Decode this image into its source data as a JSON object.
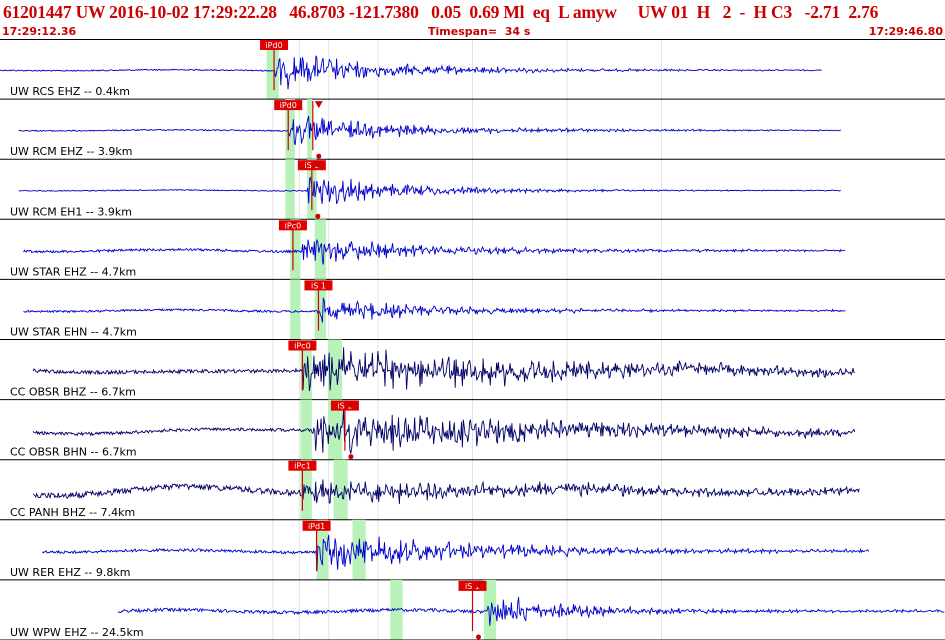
{
  "header": {
    "event_line": "61201447 UW 2016-10-02 17:29:22.28   46.8703 -121.7380   0.05  0.69 Ml  eq  L amyw     UW 01  H   2  -  H C3   -2.71  2.76",
    "start_time": "17:29:12.36",
    "timespan": "Timespan=  34 s",
    "end_time": "17:29:46.80"
  },
  "colors": {
    "header_text": "#cc0000",
    "trace": "#0000cc",
    "trace_cc": "#000066",
    "window": "#b8f2b8",
    "pick": "#cc0000",
    "pick_label_bg": "#e00000",
    "grid": "#000000"
  },
  "traces": [
    {
      "label": "UW RCS EHZ -- 0.4km",
      "color": "trace",
      "start": 0.0,
      "end": 0.87,
      "onset": 0.29,
      "amp": 22,
      "noise": 0.6,
      "decay": 0.12,
      "windows": [
        [
          0.282,
          0.295
        ]
      ],
      "picks": [
        {
          "label": "iPd0",
          "x": 0.29,
          "type": "P",
          "triangle": false
        }
      ]
    },
    {
      "label": "UW RCM EHZ -- 3.9km",
      "color": "trace",
      "start": 0.02,
      "end": 0.89,
      "onset": 0.305,
      "amp": 18,
      "noise": 0.6,
      "decay": 0.12,
      "windows": [
        [
          0.302,
          0.312
        ],
        [
          0.325,
          0.33
        ]
      ],
      "picks": [
        {
          "label": "iPd0",
          "x": 0.305,
          "type": "P",
          "triangle": false
        },
        {
          "label": "",
          "x": 0.331,
          "type": "S",
          "triangle": true
        }
      ]
    },
    {
      "label": "UW RCM EH1 -- 3.9km",
      "color": "trace",
      "start": 0.02,
      "end": 0.89,
      "onset": 0.325,
      "amp": 20,
      "noise": 0.5,
      "decay": 0.1,
      "windows": [
        [
          0.302,
          0.312
        ],
        [
          0.325,
          0.335
        ]
      ],
      "picks": [
        {
          "label": "iS 1",
          "x": 0.33,
          "type": "S",
          "triangle": true
        }
      ]
    },
    {
      "label": "UW STAR EHZ -- 4.7km",
      "color": "trace",
      "start": 0.025,
      "end": 0.895,
      "onset": 0.32,
      "amp": 16,
      "noise": 1.2,
      "decay": 0.12,
      "windows": [
        [
          0.307,
          0.318
        ],
        [
          0.333,
          0.345
        ]
      ],
      "picks": [
        {
          "label": "iPc0",
          "x": 0.31,
          "type": "P",
          "triangle": false
        }
      ]
    },
    {
      "label": "UW STAR EHN -- 4.7km",
      "color": "trace",
      "start": 0.025,
      "end": 0.895,
      "onset": 0.335,
      "amp": 14,
      "noise": 1.0,
      "decay": 0.12,
      "windows": [
        [
          0.307,
          0.318
        ],
        [
          0.333,
          0.345
        ]
      ],
      "picks": [
        {
          "label": "iS 1",
          "x": 0.337,
          "type": "S",
          "triangle": false
        }
      ]
    },
    {
      "label": "CC OBSR BHZ -- 6.7km",
      "color": "trace_cc",
      "start": 0.035,
      "end": 0.905,
      "onset": 0.32,
      "amp": 26,
      "noise": 1.8,
      "decay": 0.28,
      "windows": [
        [
          0.318,
          0.33
        ],
        [
          0.347,
          0.362
        ]
      ],
      "picks": [
        {
          "label": "iPc0",
          "x": 0.32,
          "type": "P",
          "triangle": false
        }
      ]
    },
    {
      "label": "CC OBSR BHN -- 6.7km",
      "color": "trace_cc",
      "start": 0.035,
      "end": 0.905,
      "onset": 0.33,
      "amp": 26,
      "noise": 1.5,
      "decay": 0.28,
      "windows": [
        [
          0.318,
          0.33
        ],
        [
          0.347,
          0.362
        ]
      ],
      "picks": [
        {
          "label": "iS 1",
          "x": 0.365,
          "type": "S",
          "triangle": true
        }
      ]
    },
    {
      "label": "CC PANH BHZ -- 7.4km",
      "color": "trace_cc",
      "start": 0.035,
      "end": 0.91,
      "onset": 0.32,
      "amp": 12,
      "noise": 3.0,
      "decay": 0.3,
      "windows": [
        [
          0.318,
          0.33
        ],
        [
          0.353,
          0.368
        ]
      ],
      "picks": [
        {
          "label": "iPc1",
          "x": 0.32,
          "type": "P",
          "triangle": false
        }
      ]
    },
    {
      "label": "UW RER EHZ -- 9.8km",
      "color": "trace",
      "start": 0.045,
      "end": 0.92,
      "onset": 0.335,
      "amp": 24,
      "noise": 1.4,
      "decay": 0.15,
      "windows": [
        [
          0.335,
          0.347
        ],
        [
          0.373,
          0.387
        ]
      ],
      "picks": [
        {
          "label": "iPd1",
          "x": 0.335,
          "type": "P",
          "triangle": false
        }
      ]
    },
    {
      "label": "UW WPW EHZ -- 24.5km",
      "color": "trace",
      "start": 0.125,
      "end": 1.0,
      "onset": 0.515,
      "amp": 20,
      "noise": 1.6,
      "decay": 0.08,
      "windows": [
        [
          0.413,
          0.426
        ],
        [
          0.512,
          0.525
        ]
      ],
      "picks": [
        {
          "label": "iS 1",
          "x": 0.5,
          "type": "S",
          "triangle": true
        }
      ]
    }
  ],
  "grid_ticks": [
    0.2888,
    0.3166,
    0.348,
    0.4,
    0.5,
    0.6,
    0.7
  ]
}
